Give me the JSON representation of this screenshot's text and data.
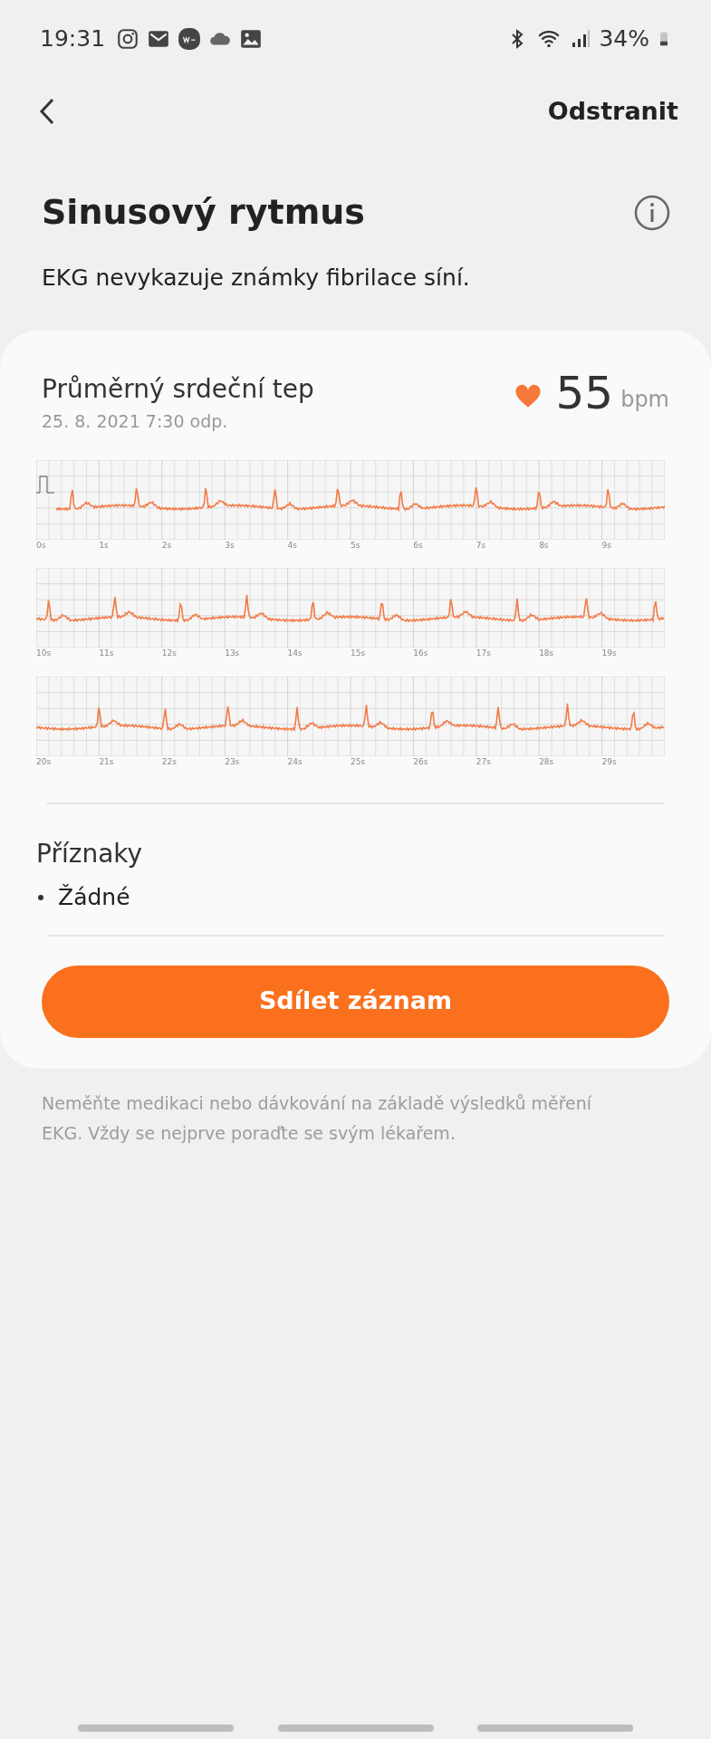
{
  "status_bar": {
    "time": "19:31",
    "battery": "34%"
  },
  "header": {
    "action": "Odstranit"
  },
  "result": {
    "title": "Sinusový rytmus",
    "description": "EKG nevykazuje známky fibrilace síní."
  },
  "card": {
    "heart_rate_label": "Průměrný srdeční tep",
    "date": "25. 8. 2021 7:30 odp.",
    "heart_rate": "55",
    "unit": "bpm",
    "strips": [
      {
        "ticks": [
          "0s",
          "1s",
          "2s",
          "3s",
          "4s",
          "5s",
          "6s",
          "7s",
          "8s",
          "9s"
        ]
      },
      {
        "ticks": [
          "10s",
          "11s",
          "12s",
          "13s",
          "14s",
          "15s",
          "16s",
          "17s",
          "18s",
          "19s"
        ]
      },
      {
        "ticks": [
          "20s",
          "21s",
          "22s",
          "23s",
          "24s",
          "25s",
          "26s",
          "27s",
          "28s",
          "29s"
        ]
      }
    ],
    "symptoms_title": "Příznaky",
    "symptoms": [
      "Žádné"
    ],
    "share_button": "Sdílet záznam"
  },
  "disclaimer": "Neměňte medikaci nebo dávkování na základě výsledků měření EKG. Vždy se nejprve poraďte se svým lékařem."
}
